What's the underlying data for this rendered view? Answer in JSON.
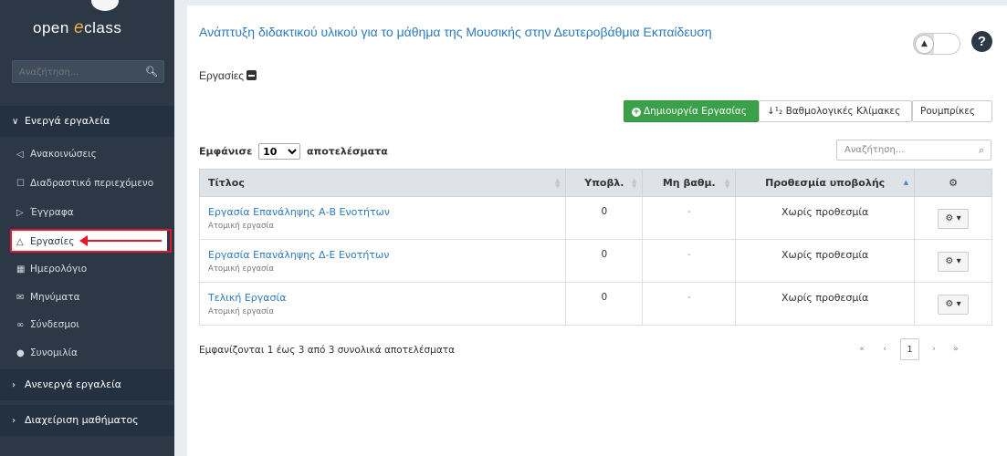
{
  "sidebar": {
    "logo_prefix": "open ",
    "logo_e": "e",
    "logo_suffix": "class",
    "search_placeholder": "Αναζήτηση...",
    "active_tools_label": "Ενεργά εργαλεία",
    "items": [
      {
        "label": "Ανακοινώσεις",
        "icon": "megaphone-icon"
      },
      {
        "label": "Διαδραστικό περιεχόμενο",
        "icon": "square-icon"
      },
      {
        "label": "Έγγραφα",
        "icon": "folder-icon"
      },
      {
        "label": "Εργασίες",
        "icon": "flask-icon"
      },
      {
        "label": "Ημερολόγιο",
        "icon": "calendar-icon"
      },
      {
        "label": "Μηνύματα",
        "icon": "envelope-icon"
      },
      {
        "label": "Σύνδεσμοι",
        "icon": "link-icon"
      },
      {
        "label": "Συνομιλία",
        "icon": "chat-icon"
      }
    ],
    "inactive_tools_label": "Ανενεργά εργαλεία",
    "course_admin_label": "Διαχείριση μαθήματος"
  },
  "header": {
    "course_title": "Ανάπτυξη διδακτικού υλικού για το μάθημα της Μουσικής στην Δευτεροβάθμια Εκπαίδευση",
    "page_title": "Εργασίες"
  },
  "toolbar": {
    "create_label": "Δημιουργία Εργασίας",
    "scales_label": "Βαθμολογικές Κλίμακες",
    "rubrics_label": "Ρουμπρίκες"
  },
  "table_controls": {
    "show_label": "Εμφάνισε",
    "page_size": "10",
    "results_label": "αποτελέσματα",
    "search_placeholder": "Αναζήτηση..."
  },
  "table": {
    "headers": [
      "Τίτλος",
      "Υποβλ.",
      "Μη βαθμ.",
      "Προθεσμία υποβολής"
    ],
    "rows": [
      {
        "title": "Εργασία Επανάληψης Α-Β Ενοτήτων",
        "type": "Ατομική εργασία",
        "submissions": "0",
        "ungraded": "-",
        "deadline": "Χωρίς προθεσμία"
      },
      {
        "title": "Εργασία Επανάληψης Δ-Ε Ενοτήτων",
        "type": "Ατομική εργασία",
        "submissions": "0",
        "ungraded": "-",
        "deadline": "Χωρίς προθεσμία"
      },
      {
        "title": "Τελική Εργασία",
        "type": "Ατομική εργασία",
        "submissions": "0",
        "ungraded": "-",
        "deadline": "Χωρίς προθεσμία"
      }
    ]
  },
  "footer": {
    "info": "Εμφανίζονται 1 έως 3 από 3 συνολικά αποτελέσματα",
    "first": "«",
    "prev": "‹",
    "page": "1",
    "next": "›",
    "last": "»"
  },
  "colors": {
    "sidebar_bg": "#2c3845",
    "link_blue": "#2e7bbd",
    "create_green": "#3aa14a",
    "highlight_red": "#e8132e"
  }
}
